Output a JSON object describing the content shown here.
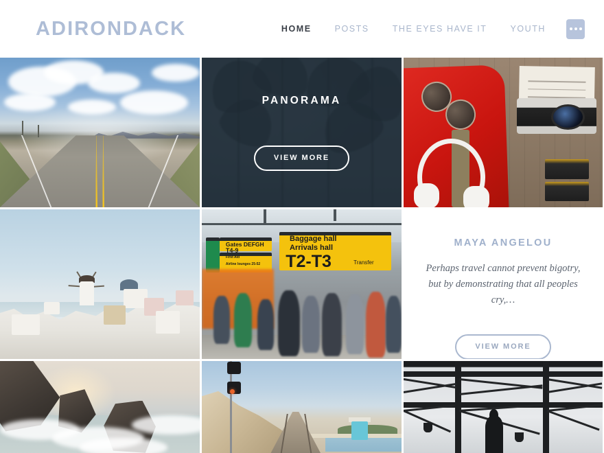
{
  "header": {
    "site_title": "ADIRONDACK",
    "nav": [
      {
        "label": "HOME",
        "active": true
      },
      {
        "label": "POSTS",
        "active": false
      },
      {
        "label": "THE EYES HAVE IT",
        "active": false
      },
      {
        "label": "YOUTH",
        "active": false
      }
    ],
    "more_button": "more-options",
    "title_color": "#aebdd6",
    "active_color": "#3a3f47",
    "nav_color": "#a9b6cc",
    "more_button_color": "#b7c4dc"
  },
  "tiles": {
    "road": {
      "name": "desert-highway-photo",
      "alt": "Empty desert highway with yellow center lines under cloudy sky"
    },
    "panorama": {
      "name": "panorama-featured-tile",
      "title": "PANORAMA",
      "button_label": "VIEW MORE",
      "alt": "Palm trees at dusk behind dark navy overlay",
      "overlay_color": "#222f3a"
    },
    "flatlay": {
      "name": "travel-gear-flatlay-photo",
      "alt": "Red backpack, sunglasses, white headphones, vintage camera and film on wood"
    },
    "santorini": {
      "name": "santorini-village-photo",
      "alt": "White Santorini hillside village with windmill and blue dome"
    },
    "airport": {
      "name": "airport-terminal-photo",
      "alt": "Busy airport concourse under yellow directional signs",
      "signs": {
        "gates": "Gates DEFGH",
        "transfer_t49": "T4-9",
        "first_aid": "First Aid",
        "lounges": "Airline lounges 25-52",
        "baggage_hall": "Baggage hall",
        "arrivals_hall": "Arrivals hall",
        "terminal": "T2-T3",
        "transfer": "Transfer"
      }
    },
    "quote": {
      "name": "maya-angelou-quote-tile",
      "author": "MAYA ANGELOU",
      "text": "Perhaps travel cannot prevent bigotry, but by demonstrating that all peoples cry,…",
      "button_label": "VIEW MORE",
      "author_color": "#9fb0cb",
      "text_color": "#5c6470",
      "button_color": "#aab8cf"
    },
    "coast": {
      "name": "rocky-coastline-photo",
      "alt": "Waves breaking over dark sea stacks at sunset"
    },
    "rail": {
      "name": "coastal-railway-photo",
      "alt": "Railroad tracks along a coastal bluff with signal mast and lifeguard tower"
    },
    "terminal": {
      "name": "terminal-silhouette-photo",
      "alt": "Silhouetted person before a steel-trussed glass terminal wall"
    }
  }
}
